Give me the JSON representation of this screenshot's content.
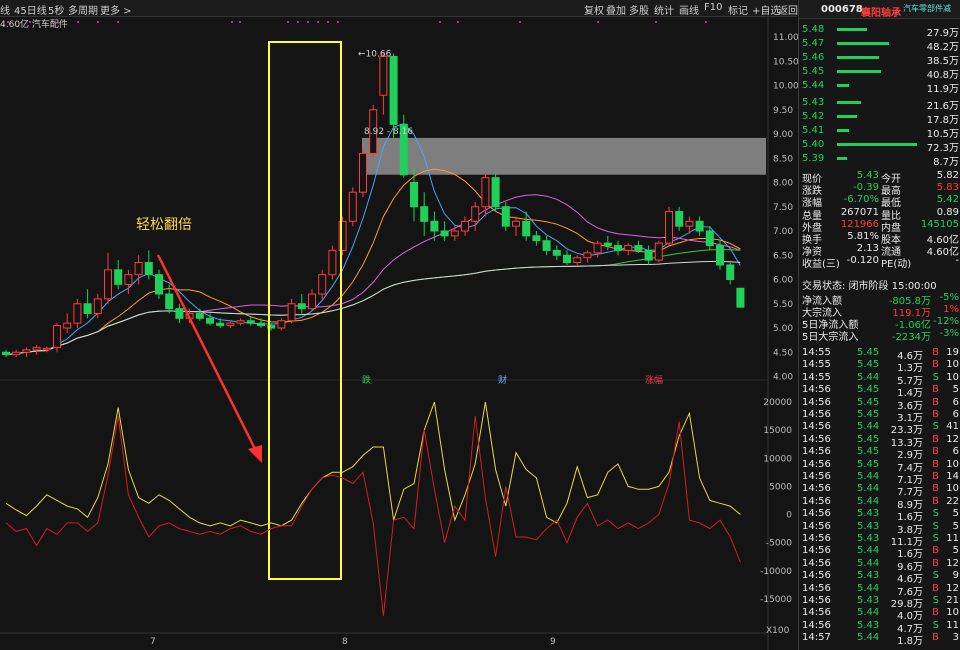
{
  "toolbar": {
    "left": [
      "线",
      "45日线",
      "5秒",
      "多周期",
      "更多 >"
    ],
    "right": [
      "复权",
      "叠加",
      "多股",
      "统计",
      "画线",
      "F10",
      "标记",
      "+自选",
      "返回"
    ]
  },
  "chart_info": {
    "volume_label": "4.60亿",
    "sector": "汽车配件",
    "annotation": "轻松翻倍"
  },
  "price_labels": {
    "peak": "10.66",
    "range": "8.92 - 8.16"
  },
  "events": [
    "跌",
    "财",
    "涨幅"
  ],
  "y_axis_price": [
    "11.00",
    "10.50",
    "10.00",
    "9.50",
    "9.00",
    "8.50",
    "8.00",
    "7.50",
    "7.00",
    "6.50",
    "6.00",
    "5.50",
    "5.00",
    "4.50",
    "4.00"
  ],
  "y_axis_indicator": [
    "20000",
    "15000",
    "10000",
    "5000",
    "0",
    "-5000",
    "-10000",
    "-15000"
  ],
  "y_axis_unit": "X100",
  "x_axis": [
    "7",
    "8",
    "9"
  ],
  "chart_data": {
    "type": "candlestick",
    "ylim": [
      4.0,
      11.0
    ],
    "candles": [
      [
        4.5,
        4.55,
        4.4,
        4.45
      ],
      [
        4.45,
        4.55,
        4.4,
        4.5
      ],
      [
        4.5,
        4.6,
        4.4,
        4.55
      ],
      [
        4.55,
        4.65,
        4.45,
        4.6
      ],
      [
        4.55,
        4.62,
        4.5,
        4.58
      ],
      [
        4.6,
        5.1,
        4.5,
        5.05
      ],
      [
        5.0,
        5.3,
        4.9,
        5.1
      ],
      [
        5.1,
        5.6,
        5.0,
        5.5
      ],
      [
        5.5,
        5.8,
        5.2,
        5.3
      ],
      [
        5.3,
        5.7,
        5.2,
        5.6
      ],
      [
        5.6,
        6.55,
        5.5,
        6.2
      ],
      [
        6.2,
        6.4,
        5.8,
        5.9
      ],
      [
        5.9,
        6.2,
        5.7,
        6.1
      ],
      [
        6.1,
        6.5,
        5.9,
        6.35
      ],
      [
        6.35,
        6.6,
        6.0,
        6.1
      ],
      [
        6.1,
        6.2,
        5.6,
        5.7
      ],
      [
        5.7,
        5.9,
        5.3,
        5.4
      ],
      [
        5.4,
        5.5,
        5.1,
        5.2
      ],
      [
        5.2,
        5.4,
        5.1,
        5.3
      ],
      [
        5.3,
        5.4,
        5.15,
        5.2
      ],
      [
        5.2,
        5.3,
        5.05,
        5.1
      ],
      [
        5.1,
        5.2,
        5.0,
        5.05
      ],
      [
        5.05,
        5.15,
        5.0,
        5.1
      ],
      [
        5.1,
        5.2,
        5.05,
        5.15
      ],
      [
        5.15,
        5.25,
        5.05,
        5.1
      ],
      [
        5.1,
        5.2,
        5.0,
        5.05
      ],
      [
        5.05,
        5.1,
        4.95,
        5.0
      ],
      [
        5.0,
        5.2,
        4.95,
        5.15
      ],
      [
        5.15,
        5.6,
        5.1,
        5.5
      ],
      [
        5.5,
        5.7,
        5.3,
        5.4
      ],
      [
        5.4,
        5.8,
        5.35,
        5.7
      ],
      [
        5.7,
        6.2,
        5.6,
        6.1
      ],
      [
        6.1,
        6.7,
        6.0,
        6.6
      ],
      [
        6.6,
        7.3,
        6.5,
        7.2
      ],
      [
        7.2,
        7.9,
        7.1,
        7.8
      ],
      [
        7.8,
        8.7,
        7.7,
        8.6
      ],
      [
        8.6,
        9.6,
        8.5,
        9.5
      ],
      [
        9.8,
        10.66,
        9.4,
        10.6
      ],
      [
        10.6,
        10.66,
        8.92,
        9.2
      ],
      [
        9.2,
        9.4,
        8.1,
        8.16
      ],
      [
        8.0,
        8.3,
        7.2,
        7.5
      ],
      [
        7.5,
        7.8,
        6.9,
        7.2
      ],
      [
        7.2,
        7.4,
        6.8,
        7.0
      ],
      [
        7.0,
        7.2,
        6.8,
        6.9
      ],
      [
        6.9,
        7.1,
        6.8,
        7.0
      ],
      [
        7.0,
        7.3,
        6.9,
        7.2
      ],
      [
        7.2,
        7.6,
        7.0,
        7.5
      ],
      [
        7.5,
        8.2,
        7.3,
        8.1
      ],
      [
        8.1,
        8.2,
        7.4,
        7.5
      ],
      [
        7.5,
        7.6,
        7.0,
        7.1
      ],
      [
        7.1,
        7.3,
        6.9,
        7.2
      ],
      [
        7.2,
        7.4,
        6.8,
        6.9
      ],
      [
        6.9,
        7.0,
        6.7,
        6.8
      ],
      [
        6.8,
        6.9,
        6.5,
        6.6
      ],
      [
        6.6,
        6.7,
        6.4,
        6.5
      ],
      [
        6.5,
        6.6,
        6.3,
        6.35
      ],
      [
        6.35,
        6.5,
        6.3,
        6.45
      ],
      [
        6.45,
        6.6,
        6.35,
        6.55
      ],
      [
        6.55,
        6.8,
        6.45,
        6.75
      ],
      [
        6.75,
        6.9,
        6.6,
        6.7
      ],
      [
        6.7,
        6.8,
        6.5,
        6.6
      ],
      [
        6.6,
        6.75,
        6.5,
        6.7
      ],
      [
        6.7,
        6.8,
        6.55,
        6.6
      ],
      [
        6.6,
        6.7,
        6.3,
        6.4
      ],
      [
        6.4,
        6.8,
        6.35,
        6.75
      ],
      [
        6.75,
        7.5,
        6.7,
        7.4
      ],
      [
        7.4,
        7.5,
        7.0,
        7.1
      ],
      [
        7.1,
        7.3,
        6.95,
        7.2
      ],
      [
        7.2,
        7.3,
        6.9,
        7.0
      ],
      [
        7.0,
        7.1,
        6.6,
        6.7
      ],
      [
        6.7,
        6.8,
        6.2,
        6.3
      ],
      [
        6.3,
        6.35,
        5.9,
        6.0
      ],
      [
        5.82,
        5.82,
        5.42,
        5.43
      ]
    ],
    "indicator": {
      "yellow": [
        2000,
        800,
        -200,
        1500,
        3500,
        2500,
        1500,
        1000,
        -500,
        3000,
        9000,
        19000,
        8000,
        3000,
        2000,
        3500,
        2500,
        1000,
        -500,
        -1500,
        -2000,
        -1500,
        -2000,
        -1000,
        -1500,
        -2000,
        -1500,
        -2000,
        -1000,
        2000,
        4500,
        6500,
        7500,
        7500,
        8500,
        10500,
        12000,
        12000,
        -1000,
        4500,
        5500,
        15000,
        20000,
        8000,
        -1000,
        3500,
        9000,
        20000,
        8000,
        1500,
        11000,
        8000,
        6500,
        -500,
        -1500,
        2000,
        8500,
        3000,
        3500,
        7500,
        9000,
        5000,
        4500,
        4500,
        5000,
        7500,
        14000,
        18000,
        6500,
        2500,
        2000,
        1500,
        0
      ],
      "red": [
        -1500,
        -3000,
        -2500,
        -5500,
        -2500,
        -3500,
        -1500,
        -1500,
        -3000,
        -1500,
        7000,
        17500,
        3500,
        -500,
        -4000,
        -2000,
        -1500,
        -2500,
        -3000,
        -3500,
        -3000,
        -3500,
        -2500,
        -2000,
        -3000,
        -3500,
        -2500,
        -2000,
        -2000,
        1500,
        4500,
        6500,
        7000,
        6500,
        5500,
        7500,
        -1500,
        -18000,
        -1000,
        -500,
        -2500,
        15000,
        4500,
        -5000,
        1500,
        -1000,
        17500,
        3000,
        -7500,
        5000,
        -4000,
        -4000,
        -4500,
        -2500,
        -1000,
        -5000,
        -500,
        2000,
        -2000,
        -1000,
        -2500,
        -1500,
        -2500,
        -1500,
        0,
        5500,
        16500,
        -1000,
        -1500,
        -2500,
        -1000,
        -4000,
        -8500
      ]
    }
  },
  "stock": {
    "code": "000678",
    "name": "襄阳轴承",
    "sector": "汽车零部件减"
  },
  "asks": [
    {
      "price": "5.48",
      "vol": "27.9万"
    },
    {
      "price": "5.47",
      "vol": "48.2万"
    },
    {
      "price": "5.46",
      "vol": "38.5万"
    },
    {
      "price": "5.45",
      "vol": "40.8万"
    },
    {
      "price": "5.44",
      "vol": "11.9万"
    }
  ],
  "bids": [
    {
      "price": "5.43",
      "vol": "21.6万"
    },
    {
      "price": "5.42",
      "vol": "17.8万"
    },
    {
      "price": "5.41",
      "vol": "10.5万"
    },
    {
      "price": "5.40",
      "vol": "72.3万"
    },
    {
      "price": "5.39",
      "vol": "8.7万"
    }
  ],
  "quote": [
    {
      "l1": "现价",
      "v1": "5.43",
      "c1": "green",
      "l2": "今开",
      "v2": "5.82",
      "c2": "white"
    },
    {
      "l1": "涨跌",
      "v1": "-0.39",
      "c1": "green",
      "l2": "最高",
      "v2": "5.83",
      "c2": "red"
    },
    {
      "l1": "涨幅",
      "v1": "-6.70%",
      "c1": "green",
      "l2": "最低",
      "v2": "5.42",
      "c2": "green"
    },
    {
      "l1": "总量",
      "v1": "267071",
      "c1": "white",
      "l2": "量比",
      "v2": "0.89",
      "c2": "white"
    },
    {
      "l1": "外盘",
      "v1": "121966",
      "c1": "red",
      "l2": "内盘",
      "v2": "145105",
      "c2": "green"
    },
    {
      "l1": "换手",
      "v1": "5.81%",
      "c1": "white",
      "l2": "股本",
      "v2": "4.60亿",
      "c2": "white"
    },
    {
      "l1": "净资",
      "v1": "2.13",
      "c1": "white",
      "l2": "流通",
      "v2": "4.60亿",
      "c2": "white"
    },
    {
      "l1": "收益(三)",
      "v1": "-0.120",
      "c1": "white",
      "l2": "PE(动)",
      "v2": "-",
      "c2": "white"
    }
  ],
  "trade_status": "交易状态: 闭市阶段 15:00:00",
  "flows": [
    {
      "label": "净流入额",
      "value": "-805.8万",
      "pct": "-5%"
    },
    {
      "label": "大宗流入",
      "value": "119.1万",
      "pct": "1%"
    },
    {
      "label": "5日净流入额",
      "value": "-1.06亿",
      "pct": "-12%"
    },
    {
      "label": "5日大宗流入",
      "value": "-2234万",
      "pct": "-3%"
    }
  ],
  "ticks": [
    {
      "t": "14:55",
      "p": "5.45",
      "v": "4.6万",
      "s": "B",
      "n": "19"
    },
    {
      "t": "14:55",
      "p": "5.45",
      "v": "1.3万",
      "s": "B",
      "n": "10"
    },
    {
      "t": "14:55",
      "p": "5.44",
      "v": "5.7万",
      "s": "S",
      "n": "10"
    },
    {
      "t": "14:56",
      "p": "5.45",
      "v": "1.4万",
      "s": "B",
      "n": "5"
    },
    {
      "t": "14:56",
      "p": "5.45",
      "v": "3.6万",
      "s": "B",
      "n": "6"
    },
    {
      "t": "14:56",
      "p": "5.45",
      "v": "3.1万",
      "s": "B",
      "n": "6"
    },
    {
      "t": "14:56",
      "p": "5.44",
      "v": "23.3万",
      "s": "S",
      "n": "41"
    },
    {
      "t": "14:56",
      "p": "5.45",
      "v": "13.3万",
      "s": "B",
      "n": "12"
    },
    {
      "t": "14:56",
      "p": "5.45",
      "v": "2.9万",
      "s": "B",
      "n": "6"
    },
    {
      "t": "14:56",
      "p": "5.45",
      "v": "7.4万",
      "s": "B",
      "n": "10"
    },
    {
      "t": "14:56",
      "p": "5.44",
      "v": "7.1万",
      "s": "B",
      "n": "14"
    },
    {
      "t": "14:56",
      "p": "5.44",
      "v": "7.7万",
      "s": "B",
      "n": "10"
    },
    {
      "t": "14:56",
      "p": "5.44",
      "v": "8.9万",
      "s": "B",
      "n": "22"
    },
    {
      "t": "14:56",
      "p": "5.43",
      "v": "1.6万",
      "s": "S",
      "n": "5"
    },
    {
      "t": "14:56",
      "p": "5.43",
      "v": "3.8万",
      "s": "S",
      "n": "5"
    },
    {
      "t": "14:56",
      "p": "5.43",
      "v": "11.1万",
      "s": "S",
      "n": "11"
    },
    {
      "t": "14:56",
      "p": "5.44",
      "v": "1.6万",
      "s": "B",
      "n": "5"
    },
    {
      "t": "14:56",
      "p": "5.44",
      "v": "9.6万",
      "s": "B",
      "n": "12"
    },
    {
      "t": "14:56",
      "p": "5.43",
      "v": "4.6万",
      "s": "S",
      "n": "9"
    },
    {
      "t": "14:56",
      "p": "5.44",
      "v": "7.6万",
      "s": "B",
      "n": "12"
    },
    {
      "t": "14:56",
      "p": "5.43",
      "v": "29.8万",
      "s": "S",
      "n": "21"
    },
    {
      "t": "14:56",
      "p": "5.44",
      "v": "4.0万",
      "s": "B",
      "n": "10"
    },
    {
      "t": "14:56",
      "p": "5.43",
      "v": "4.7万",
      "s": "S",
      "n": "11"
    },
    {
      "t": "14:57",
      "p": "5.44",
      "v": "1.8万",
      "s": "B",
      "n": "3"
    }
  ],
  "colors": {
    "up": "#ff3b3b",
    "down": "#1fd15a",
    "bg": "#141414",
    "highlight": "#ffff33"
  }
}
